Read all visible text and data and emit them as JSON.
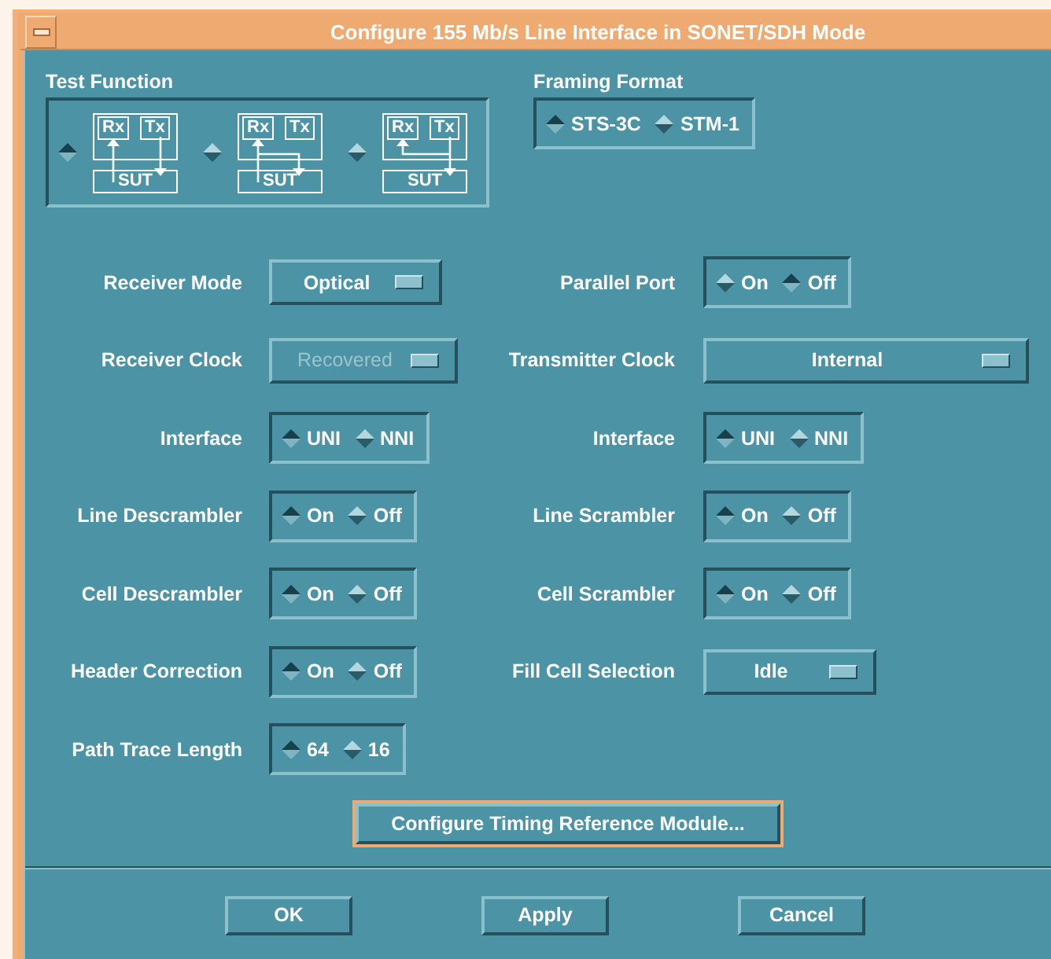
{
  "window": {
    "title": "Configure 155 Mb/s Line Interface in SONET/SDH  Mode"
  },
  "test_function": {
    "label": "Test Function",
    "options": [
      {
        "kind": "separate",
        "rx": "Rx",
        "tx": "Tx",
        "sut": "SUT",
        "selected": true
      },
      {
        "kind": "rx-loop",
        "rx": "Rx",
        "tx": "Tx",
        "sut": "SUT",
        "selected": false
      },
      {
        "kind": "tx-loop",
        "rx": "Rx",
        "tx": "Tx",
        "sut": "SUT",
        "selected": false
      }
    ]
  },
  "framing_format": {
    "label": "Framing Format",
    "options": [
      {
        "label": "STS-3C",
        "selected": true
      },
      {
        "label": "STM-1",
        "selected": false
      }
    ]
  },
  "rows": [
    {
      "left": {
        "label": "Receiver Mode",
        "kind": "menu",
        "value": "Optical",
        "disabled": false
      },
      "right": {
        "label": "Parallel Port",
        "kind": "radio",
        "options": [
          {
            "label": "On",
            "selected": false
          },
          {
            "label": "Off",
            "selected": true
          }
        ]
      }
    },
    {
      "left": {
        "label": "Receiver Clock",
        "kind": "menu",
        "value": "Recovered",
        "disabled": true
      },
      "right": {
        "label": "Transmitter Clock",
        "kind": "menu",
        "value": "Internal",
        "disabled": false,
        "wide": true
      }
    },
    {
      "left": {
        "label": "Interface",
        "kind": "radio",
        "options": [
          {
            "label": "UNI",
            "selected": true
          },
          {
            "label": "NNI",
            "selected": false
          }
        ]
      },
      "right": {
        "label": "Interface",
        "kind": "radio",
        "options": [
          {
            "label": "UNI",
            "selected": true
          },
          {
            "label": "NNI",
            "selected": false
          }
        ]
      }
    },
    {
      "left": {
        "label": "Line Descrambler",
        "kind": "radio",
        "options": [
          {
            "label": "On",
            "selected": true
          },
          {
            "label": "Off",
            "selected": false
          }
        ]
      },
      "right": {
        "label": "Line Scrambler",
        "kind": "radio",
        "options": [
          {
            "label": "On",
            "selected": true
          },
          {
            "label": "Off",
            "selected": false
          }
        ]
      }
    },
    {
      "left": {
        "label": "Cell Descrambler",
        "kind": "radio",
        "options": [
          {
            "label": "On",
            "selected": true
          },
          {
            "label": "Off",
            "selected": false
          }
        ]
      },
      "right": {
        "label": "Cell Scrambler",
        "kind": "radio",
        "options": [
          {
            "label": "On",
            "selected": true
          },
          {
            "label": "Off",
            "selected": false
          }
        ]
      }
    },
    {
      "left": {
        "label": "Header Correction",
        "kind": "radio",
        "options": [
          {
            "label": "On",
            "selected": true
          },
          {
            "label": "Off",
            "selected": false
          }
        ]
      },
      "right": {
        "label": "Fill Cell Selection",
        "kind": "menu",
        "value": "Idle",
        "disabled": false
      }
    },
    {
      "left": {
        "label": "Path Trace Length",
        "kind": "radio",
        "options": [
          {
            "label": "64",
            "selected": true
          },
          {
            "label": "16",
            "selected": false
          }
        ]
      }
    }
  ],
  "timing_button": {
    "label": "Configure Timing Reference Module...",
    "focused": true
  },
  "buttons": [
    "OK",
    "Apply",
    "Cancel"
  ]
}
